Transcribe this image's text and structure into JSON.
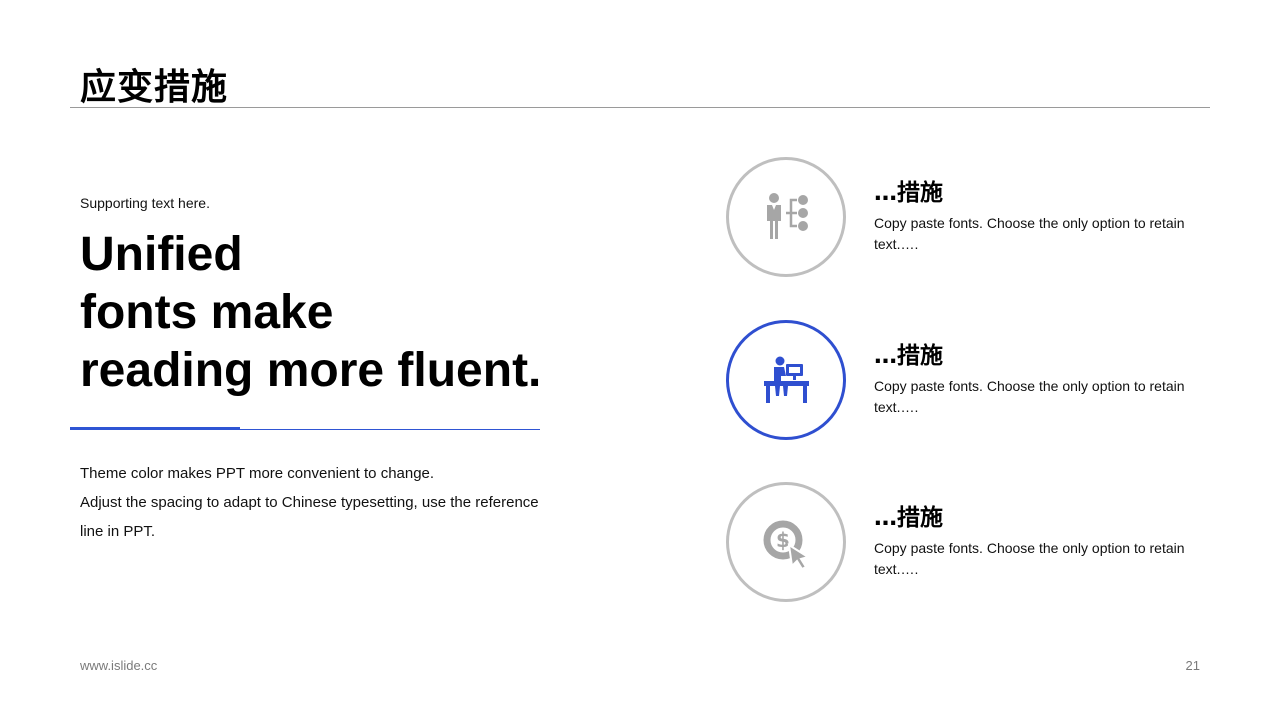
{
  "slide": {
    "title": "应变措施",
    "supporting_text": "Supporting  text here.",
    "headline_lines": [
      "Unified",
      "fonts make",
      "reading more fluent."
    ],
    "body_lines": [
      "Theme color makes PPT more convenient to change.",
      "Adjust the spacing to adapt to Chinese typesetting, use the reference",
      "line in PPT."
    ],
    "accent_color": "#2f4fd0",
    "neutral_icon_color": "#a6a6a6"
  },
  "measures": [
    {
      "title": "…措施",
      "desc": "Copy paste fonts. Choose the only option to retain text.….",
      "icon": "person-org-chart-icon",
      "active": false
    },
    {
      "title": "…措施",
      "desc": "Copy paste fonts. Choose the only option to retain text.….",
      "icon": "person-at-desk-icon",
      "active": true
    },
    {
      "title": "…措施",
      "desc": "Copy paste fonts. Choose the only option to retain text.….",
      "icon": "dollar-click-icon",
      "active": false
    }
  ],
  "footer": {
    "website": "www.islide.cc",
    "page_number": "21"
  }
}
